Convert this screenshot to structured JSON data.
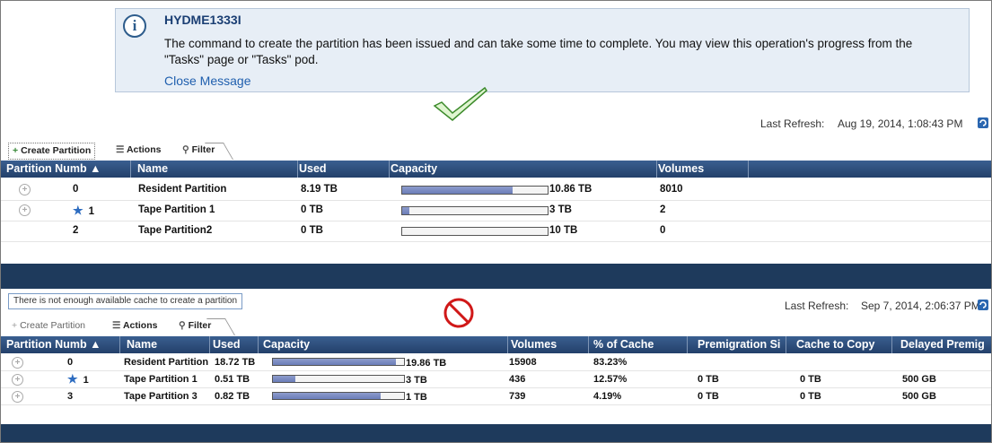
{
  "message": {
    "code": "HYDME1333I",
    "text": "The command to create the partition has been issued and can take some time to complete. You may view this operation's progress from the \"Tasks\" page or \"Tasks\" pod.",
    "close_link": "Close Message"
  },
  "panel1": {
    "last_refresh_label": "Last Refresh:",
    "last_refresh_value": "Aug 19, 2014, 1:08:43 PM",
    "toolbar": {
      "create": "Create Partition",
      "actions": "Actions",
      "filter": "Filter"
    },
    "columns": [
      "Partition Numb",
      "Name",
      "Used",
      "Capacity",
      "Volumes"
    ],
    "rows": [
      {
        "num": "0",
        "name": "Resident Partition",
        "used": "8.19 TB",
        "capacity": "10.86 TB",
        "capacity_fill": 0.76,
        "volumes": "8010",
        "starred": false,
        "expandable": true
      },
      {
        "num": "1",
        "name": "Tape Partition 1",
        "used": "0 TB",
        "capacity": "3 TB",
        "capacity_fill": 0.05,
        "volumes": "2",
        "starred": true,
        "expandable": true
      },
      {
        "num": "2",
        "name": "Tape Partition2",
        "used": "0 TB",
        "capacity": "10 TB",
        "capacity_fill": 0.0,
        "volumes": "0",
        "starred": false,
        "expandable": false
      }
    ]
  },
  "panel2": {
    "tooltip": "There is not enough available cache to create a partition",
    "last_refresh_label": "Last Refresh:",
    "last_refresh_value": "Sep 7, 2014, 2:06:37 PM",
    "toolbar": {
      "create": "Create Partition",
      "actions": "Actions",
      "filter": "Filter"
    },
    "columns": [
      "Partition Numb",
      "Name",
      "Used",
      "Capacity",
      "Volumes",
      "% of Cache",
      "Premigration Si",
      "Cache to Copy",
      "Delayed Premig"
    ],
    "rows": [
      {
        "num": "0",
        "name": "Resident Partition",
        "used": "18.72 TB",
        "capacity": "19.86 TB",
        "capacity_fill": 0.94,
        "volumes": "15908",
        "cache": "83.23%",
        "premig": "",
        "copy": "",
        "delayed": "",
        "starred": false
      },
      {
        "num": "1",
        "name": "Tape Partition 1",
        "used": "0.51 TB",
        "capacity": "3 TB",
        "capacity_fill": 0.17,
        "volumes": "436",
        "cache": "12.57%",
        "premig": "0 TB",
        "copy": "0 TB",
        "delayed": "500 GB",
        "starred": true
      },
      {
        "num": "3",
        "name": "Tape Partition 3",
        "used": "0.82 TB",
        "capacity": "1 TB",
        "capacity_fill": 0.82,
        "volumes": "739",
        "cache": "4.19%",
        "premig": "0 TB",
        "copy": "0 TB",
        "delayed": "500 GB",
        "starred": false
      }
    ]
  }
}
